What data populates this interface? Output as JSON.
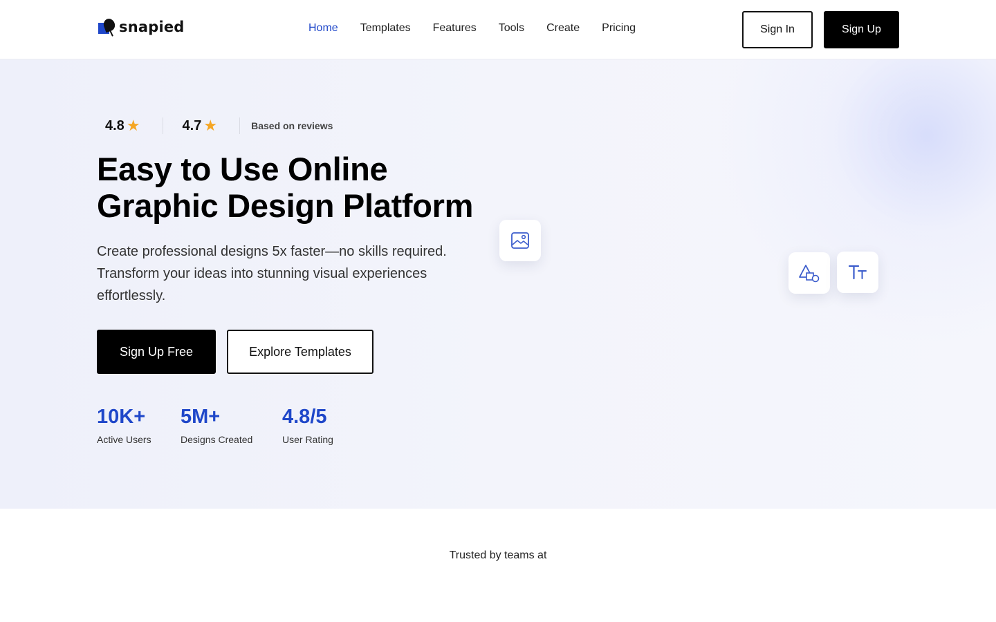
{
  "brand": {
    "name": "snapied",
    "accent": "#1f47c9"
  },
  "nav": {
    "items": [
      {
        "label": "Home",
        "active": true
      },
      {
        "label": "Templates",
        "active": false
      },
      {
        "label": "Features",
        "active": false
      },
      {
        "label": "Tools",
        "active": false
      },
      {
        "label": "Create",
        "active": false
      },
      {
        "label": "Pricing",
        "active": false
      }
    ],
    "sign_in": "Sign In",
    "sign_up": "Sign Up"
  },
  "hero": {
    "ratings": [
      {
        "value": "4.8",
        "icon": "star-icon"
      },
      {
        "value": "4.7",
        "icon": "star-icon"
      }
    ],
    "reviews_note": "Based on reviews",
    "headline_line1": "Easy to Use Online",
    "headline_line2": "Graphic Design Platform",
    "subtext": "Create professional designs 5x faster—no skills required. Transform your ideas into stunning visual experiences effortlessly.",
    "cta_primary": "Sign Up Free",
    "cta_secondary": "Explore Templates",
    "stats": [
      {
        "value": "10K+",
        "label": "Active Users"
      },
      {
        "value": "5M+",
        "label": "Designs Created"
      },
      {
        "value": "4.8/5",
        "label": "User Rating"
      }
    ],
    "tool_icons": [
      "image-icon",
      "shapes-icon",
      "text-icon"
    ]
  },
  "trusted": {
    "label": "Trusted by teams at"
  }
}
